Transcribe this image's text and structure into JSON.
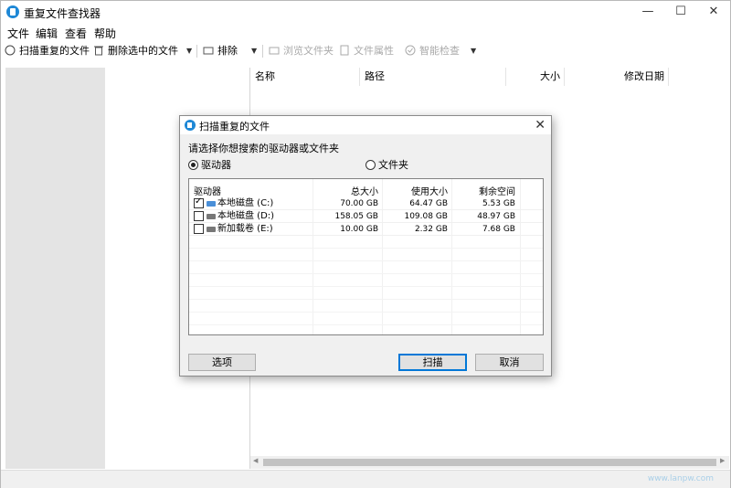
{
  "app": {
    "title": "重复文件查找器",
    "window_buttons": {
      "minimize": "—",
      "maximize": "☐",
      "close": "✕"
    }
  },
  "menu": [
    "文件",
    "编辑",
    "查看",
    "帮助"
  ],
  "toolbar": {
    "scan": "扫描重复的文件",
    "delete_selected": "删除选中的文件",
    "exclude": "排除",
    "browse_folder": "浏览文件夹",
    "file_properties": "文件属性",
    "smart_check": "智能检查"
  },
  "file_list": {
    "columns": [
      "名称",
      "路径",
      "大小",
      "修改日期"
    ]
  },
  "dialog": {
    "title": "扫描重复的文件",
    "prompt": "请选择你想搜索的驱动器或文件夹",
    "radio_drives": "驱动器",
    "radio_folder": "文件夹",
    "selected_mode": "drives",
    "table_headers": [
      "驱动器",
      "总大小",
      "使用大小",
      "剩余空间"
    ],
    "drives": [
      {
        "name": "本地磁盘 (C:)",
        "total": "70.00 GB",
        "used": "64.47 GB",
        "free": "5.53 GB",
        "checked": true
      },
      {
        "name": "本地磁盘 (D:)",
        "total": "158.05 GB",
        "used": "109.08 GB",
        "free": "48.97 GB",
        "checked": false
      },
      {
        "name": "新加载卷 (E:)",
        "total": "10.00 GB",
        "used": "2.32 GB",
        "free": "7.68 GB",
        "checked": false
      }
    ],
    "buttons": {
      "options": "选项",
      "scan": "扫描",
      "cancel": "取消"
    }
  },
  "status": {
    "watermark": "www.lanpw.com"
  },
  "colors": {
    "accent": "#0078d7",
    "icon_blue": "#1e88d6"
  }
}
